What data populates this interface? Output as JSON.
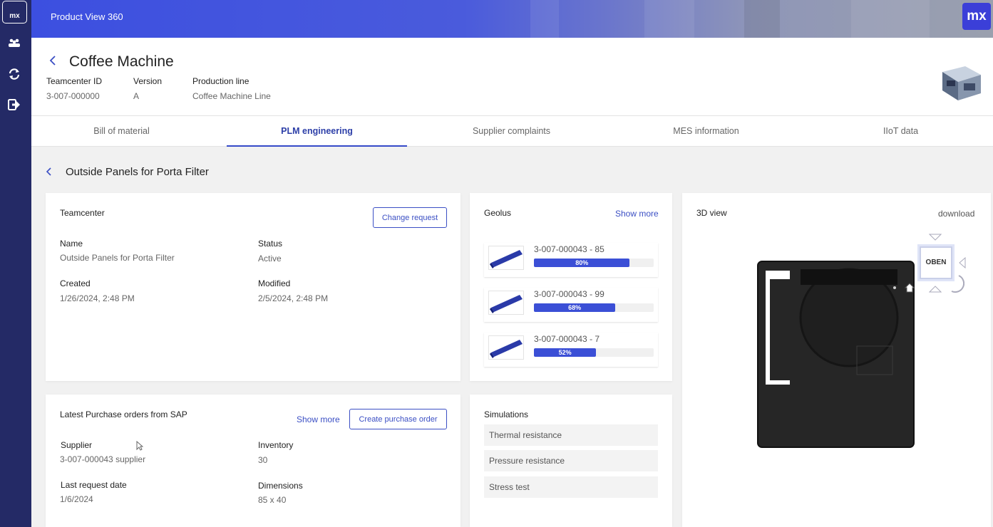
{
  "app": {
    "logo_text": "mx",
    "title": "Product View 360",
    "brand_badge": "mx"
  },
  "rail": {
    "icons": [
      "people-icon",
      "sync-icon",
      "logout-icon"
    ]
  },
  "product": {
    "name": "Coffee Machine",
    "meta": [
      {
        "key": "Teamcenter ID",
        "value": "3-007-000000"
      },
      {
        "key": "Version",
        "value": "A"
      },
      {
        "key": "Production line",
        "value": "Coffee Machine Line"
      }
    ]
  },
  "tabs": [
    {
      "label": "Bill of material"
    },
    {
      "label": "PLM engineering",
      "active": true
    },
    {
      "label": "Supplier complaints"
    },
    {
      "label": "MES information"
    },
    {
      "label": "IIoT data"
    }
  ],
  "section": {
    "title": "Outside Panels for Porta Filter"
  },
  "teamcenter": {
    "title": "Teamcenter",
    "button": "Change request",
    "fields": {
      "name_label": "Name",
      "name": "Outside Panels for Porta Filter",
      "status_label": "Status",
      "status": "Active",
      "created_label": "Created",
      "created": "1/26/2024, 2:48 PM",
      "modified_label": "Modified",
      "modified": "2/5/2024, 2:48 PM"
    }
  },
  "geolus": {
    "title": "Geolus",
    "show_more": "Show more",
    "items": [
      {
        "name": "3-007-000043 - 85",
        "percent": 80,
        "percent_label": "80%"
      },
      {
        "name": "3-007-000043 - 99",
        "percent": 68,
        "percent_label": "68%"
      },
      {
        "name": "3-007-000043 - 7",
        "percent": 52,
        "percent_label": "52%"
      }
    ]
  },
  "view3d": {
    "title": "3D view",
    "download": "download",
    "cube_label": "OBEN"
  },
  "purchase": {
    "title": "Latest Purchase orders from SAP",
    "show_more": "Show more",
    "button": "Create purchase order",
    "fields": {
      "supplier_label": "Supplier",
      "supplier": "3-007-000043 supplier",
      "inventory_label": "Inventory",
      "inventory": "30",
      "last_request_label": "Last request date",
      "last_request": "1/6/2024",
      "dimensions_label": "Dimensions",
      "dimensions": "85 x 40"
    }
  },
  "simulations": {
    "title": "Simulations",
    "items": [
      "Thermal resistance",
      "Pressure resistance",
      "Stress test"
    ]
  },
  "colors": {
    "accent": "#3b4fd6",
    "rail": "#242a66",
    "header": "#3c4fe0"
  }
}
